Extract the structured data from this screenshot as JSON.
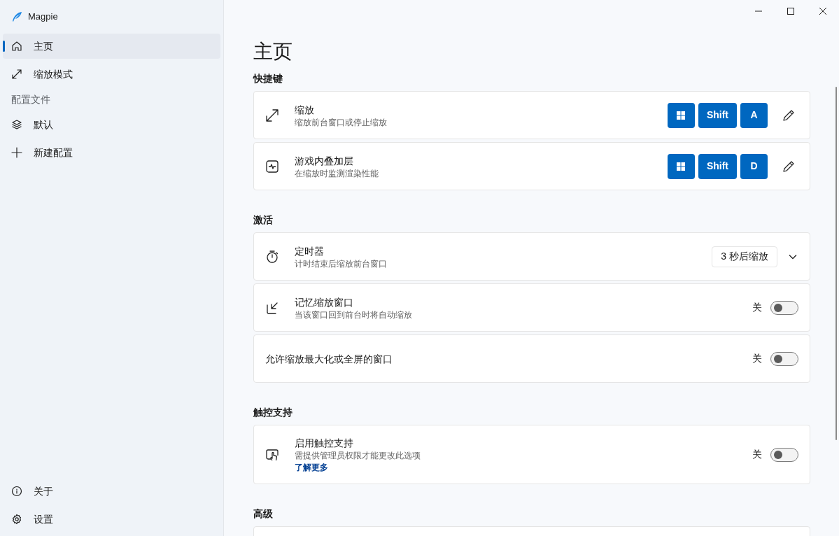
{
  "app_title": "Magpie",
  "nav": [
    {
      "label": "主页",
      "selected": true
    },
    {
      "label": "缩放模式",
      "selected": false
    }
  ],
  "profiles_header": "配置文件",
  "profiles": [
    {
      "label": "默认",
      "selected": false
    },
    {
      "label": "新建配置",
      "selected": false
    }
  ],
  "footer_nav": [
    {
      "label": "关于",
      "selected": false
    },
    {
      "label": "设置",
      "selected": false
    }
  ],
  "page_title": "主页",
  "sections": [
    {
      "heading": "快捷键",
      "cards": [
        {
          "title": "缩放",
          "description": "缩放前台窗口或停止缩放",
          "control": {
            "kind": "shortcut",
            "keys": [
              {
                "kind": "win"
              },
              {
                "kind": "text",
                "label": "Shift"
              },
              {
                "kind": "text",
                "label": "A"
              }
            ]
          }
        },
        {
          "title": "游戏内叠加层",
          "description": "在缩放时监测渲染性能",
          "control": {
            "kind": "shortcut",
            "keys": [
              {
                "kind": "win"
              },
              {
                "kind": "text",
                "label": "Shift"
              },
              {
                "kind": "text",
                "label": "D"
              }
            ]
          }
        }
      ]
    },
    {
      "heading": "激活",
      "cards": [
        {
          "title": "定时器",
          "description": "计时结束后缩放前台窗口",
          "control": {
            "kind": "dropdown",
            "value": "3 秒后缩放"
          }
        },
        {
          "title": "记忆缩放窗口",
          "description": "当该窗口回到前台时将自动缩放",
          "control": {
            "kind": "toggle",
            "on": false,
            "state_label": "关"
          }
        },
        {
          "title": "允许缩放最大化或全屏的窗口",
          "control": {
            "kind": "toggle",
            "on": false,
            "state_label": "关"
          }
        }
      ]
    },
    {
      "heading": "触控支持",
      "cards": [
        {
          "title": "启用触控支持",
          "description": "需提供管理员权限才能更改此选项",
          "link": "了解更多",
          "control": {
            "kind": "toggle",
            "on": false,
            "state_label": "关"
          }
        }
      ]
    },
    {
      "heading": "高级"
    }
  ]
}
